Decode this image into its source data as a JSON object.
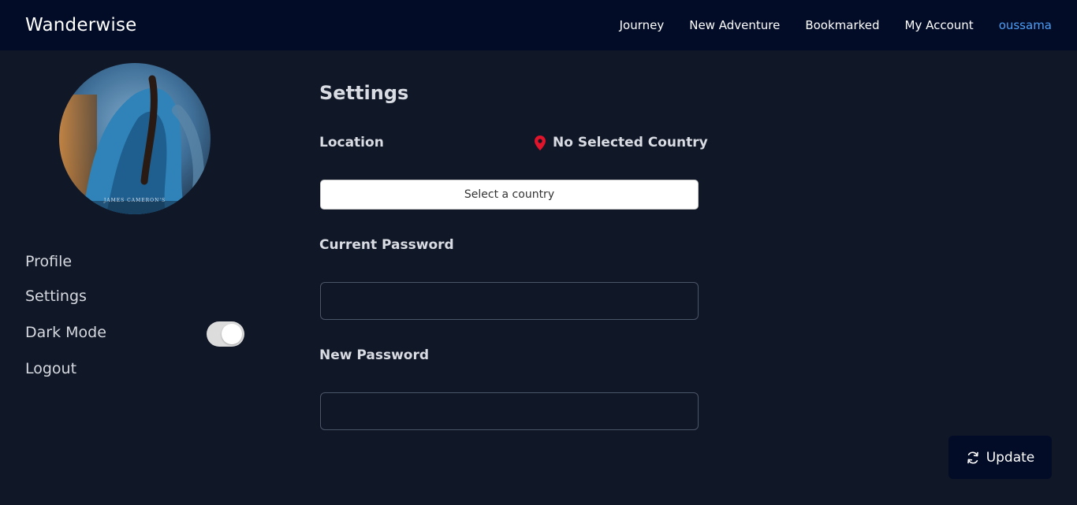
{
  "navbar": {
    "brand": "Wanderwise",
    "links": [
      "Journey",
      "New Adventure",
      "Bookmarked",
      "My Account"
    ],
    "username": "oussama"
  },
  "sidebar": {
    "avatar_caption": "JAMES CAMERON'S",
    "items": [
      "Profile",
      "Settings",
      "Dark Mode",
      "Logout"
    ],
    "dark_mode_enabled": true
  },
  "settings": {
    "title": "Settings",
    "location_label": "Location",
    "location_status": "No Selected Country",
    "country_select_label": "Select a country",
    "current_password_label": "Current Password",
    "current_password_value": "",
    "new_password_label": "New Password",
    "new_password_value": "",
    "update_label": "Update"
  },
  "colors": {
    "navbar_bg": "#020c27",
    "page_bg": "#101727",
    "accent_user": "#4d9df5",
    "pin": "#e0142a"
  },
  "icons": {
    "location": "map-pin-icon",
    "update": "refresh-icon"
  }
}
